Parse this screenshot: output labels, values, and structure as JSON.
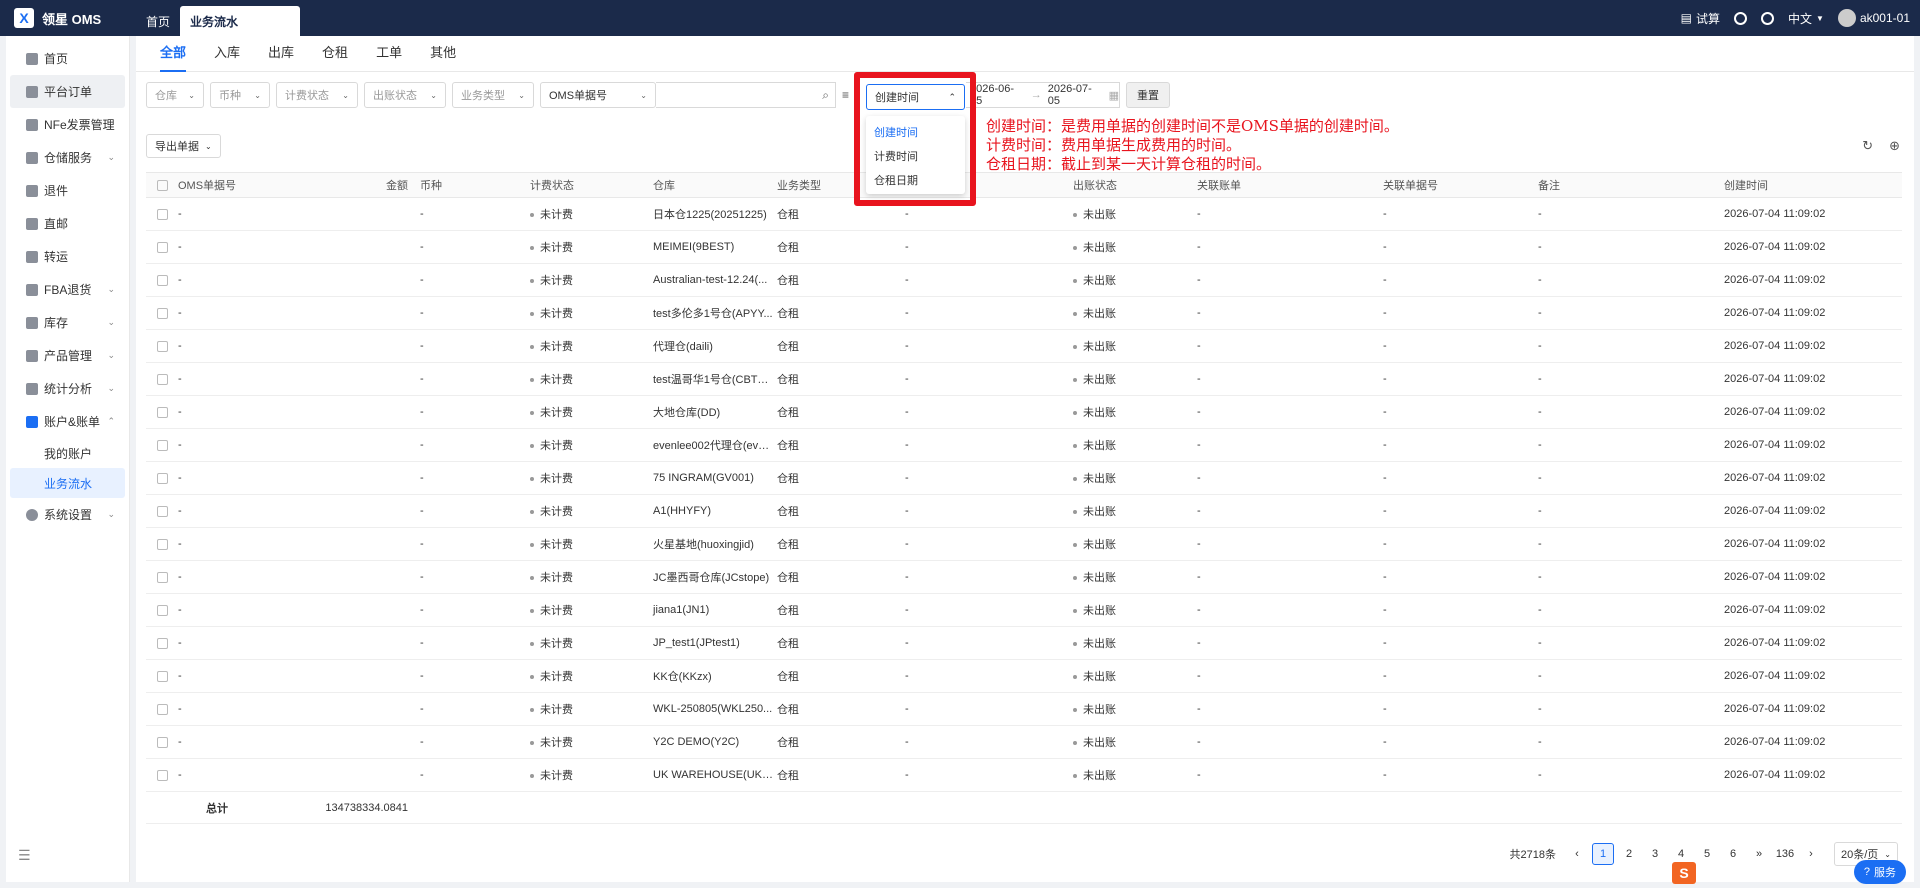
{
  "topbar": {
    "brand_logo": "X",
    "brand": "领星 OMS",
    "tabs": [
      {
        "label": "首页",
        "active": false
      },
      {
        "label": "业务流水",
        "active": true
      }
    ],
    "right": {
      "trial": "试算",
      "language": "中文",
      "user": "ak001-01"
    }
  },
  "sidebar": {
    "items": [
      {
        "label": "首页",
        "icon": "home-icon",
        "expandable": false
      },
      {
        "label": "平台订单",
        "icon": "order-icon",
        "expandable": false
      },
      {
        "label": "NFe发票管理",
        "icon": "invoice-icon",
        "expandable": false
      },
      {
        "label": "仓储服务",
        "icon": "warehouse-icon",
        "expandable": true
      },
      {
        "label": "退件",
        "icon": "return-icon",
        "expandable": false
      },
      {
        "label": "直邮",
        "icon": "mail-icon",
        "expandable": false
      },
      {
        "label": "转运",
        "icon": "transfer-icon",
        "expandable": false
      },
      {
        "label": "FBA退货",
        "icon": "fba-icon",
        "expandable": true
      },
      {
        "label": "库存",
        "icon": "inventory-icon",
        "expandable": true
      },
      {
        "label": "产品管理",
        "icon": "product-icon",
        "expandable": true
      },
      {
        "label": "统计分析",
        "icon": "stats-icon",
        "expandable": true
      },
      {
        "label": "账户&账单",
        "icon": "account-icon",
        "expandable": true,
        "expanded": true
      },
      {
        "label": "我的账户",
        "sub": true
      },
      {
        "label": "业务流水",
        "sub": true,
        "active": true
      },
      {
        "label": "系统设置",
        "icon": "settings-icon",
        "expandable": true
      }
    ]
  },
  "category_tabs": [
    {
      "label": "全部",
      "active": true
    },
    {
      "label": "入库"
    },
    {
      "label": "出库"
    },
    {
      "label": "仓租"
    },
    {
      "label": "工单"
    },
    {
      "label": "其他"
    }
  ],
  "filters": {
    "warehouse": "仓库",
    "currency": "币种",
    "fee_status": "计费状态",
    "bill_status": "出账状态",
    "biz_type": "业务类型",
    "oms_no": "OMS单据号",
    "date_start": "2026-06-05",
    "date_end": "2026-07-05",
    "reset": "重置"
  },
  "date_dropdown": {
    "selected": "创建时间",
    "options": [
      "创建时间",
      "计费时间",
      "仓租日期"
    ]
  },
  "annotations": [
    "创建时间：是费用单据的创建时间不是OMS单据的创建时间。",
    "计费时间：费用单据生成费用的时间。",
    "仓租日期：截止到某一天计算仓租的时间。"
  ],
  "export_button": "导出单据",
  "table": {
    "headers": [
      "OMS单据号",
      "金额",
      "币种",
      "计费状态",
      "仓库",
      "业务类型",
      "出账状态",
      "关联账单",
      "关联单据号",
      "备注",
      "创建时间"
    ],
    "rows": [
      {
        "oms": "-",
        "cur": "-",
        "fee": "未计费",
        "wh": "日本仓1225(20251225)",
        "biz": "仓租",
        "blank": "-",
        "out": "未出账",
        "bill": "-",
        "ref": "-",
        "note": "-",
        "time": "2026-07-04 11:09:02"
      },
      {
        "oms": "-",
        "cur": "-",
        "fee": "未计费",
        "wh": "MEIMEI(9BEST)",
        "biz": "仓租",
        "blank": "-",
        "out": "未出账",
        "bill": "-",
        "ref": "-",
        "note": "-",
        "time": "2026-07-04 11:09:02"
      },
      {
        "oms": "-",
        "cur": "-",
        "fee": "未计费",
        "wh": "Australian-test-12.24(...",
        "biz": "仓租",
        "blank": "-",
        "out": "未出账",
        "bill": "-",
        "ref": "-",
        "note": "-",
        "time": "2026-07-04 11:09:02"
      },
      {
        "oms": "-",
        "cur": "-",
        "fee": "未计费",
        "wh": "test多伦多1号仓(APYY...",
        "biz": "仓租",
        "blank": "-",
        "out": "未出账",
        "bill": "-",
        "ref": "-",
        "note": "-",
        "time": "2026-07-04 11:09:02"
      },
      {
        "oms": "-",
        "cur": "-",
        "fee": "未计费",
        "wh": "代理仓(daili)",
        "biz": "仓租",
        "blank": "-",
        "out": "未出账",
        "bill": "-",
        "ref": "-",
        "note": "-",
        "time": "2026-07-04 11:09:02"
      },
      {
        "oms": "-",
        "cur": "-",
        "fee": "未计费",
        "wh": "test温哥华1号仓(CBTO...",
        "biz": "仓租",
        "blank": "-",
        "out": "未出账",
        "bill": "-",
        "ref": "-",
        "note": "-",
        "time": "2026-07-04 11:09:02"
      },
      {
        "oms": "-",
        "cur": "-",
        "fee": "未计费",
        "wh": "大地仓库(DD)",
        "biz": "仓租",
        "blank": "-",
        "out": "未出账",
        "bill": "-",
        "ref": "-",
        "note": "-",
        "time": "2026-07-04 11:09:02"
      },
      {
        "oms": "-",
        "cur": "-",
        "fee": "未计费",
        "wh": "evenlee002代理仓(eve...",
        "biz": "仓租",
        "blank": "-",
        "out": "未出账",
        "bill": "-",
        "ref": "-",
        "note": "-",
        "time": "2026-07-04 11:09:02"
      },
      {
        "oms": "-",
        "cur": "-",
        "fee": "未计费",
        "wh": "75 INGRAM(GV001)",
        "biz": "仓租",
        "blank": "-",
        "out": "未出账",
        "bill": "-",
        "ref": "-",
        "note": "-",
        "time": "2026-07-04 11:09:02"
      },
      {
        "oms": "-",
        "cur": "-",
        "fee": "未计费",
        "wh": "A1(HHYFY)",
        "biz": "仓租",
        "blank": "-",
        "out": "未出账",
        "bill": "-",
        "ref": "-",
        "note": "-",
        "time": "2026-07-04 11:09:02"
      },
      {
        "oms": "-",
        "cur": "-",
        "fee": "未计费",
        "wh": "火星基地(huoxingjid)",
        "biz": "仓租",
        "blank": "-",
        "out": "未出账",
        "bill": "-",
        "ref": "-",
        "note": "-",
        "time": "2026-07-04 11:09:02"
      },
      {
        "oms": "-",
        "cur": "-",
        "fee": "未计费",
        "wh": "JC墨西哥仓库(JCstope)",
        "biz": "仓租",
        "blank": "-",
        "out": "未出账",
        "bill": "-",
        "ref": "-",
        "note": "-",
        "time": "2026-07-04 11:09:02"
      },
      {
        "oms": "-",
        "cur": "-",
        "fee": "未计费",
        "wh": "jiana1(JN1)",
        "biz": "仓租",
        "blank": "-",
        "out": "未出账",
        "bill": "-",
        "ref": "-",
        "note": "-",
        "time": "2026-07-04 11:09:02"
      },
      {
        "oms": "-",
        "cur": "-",
        "fee": "未计费",
        "wh": "JP_test1(JPtest1)",
        "biz": "仓租",
        "blank": "-",
        "out": "未出账",
        "bill": "-",
        "ref": "-",
        "note": "-",
        "time": "2026-07-04 11:09:02"
      },
      {
        "oms": "-",
        "cur": "-",
        "fee": "未计费",
        "wh": "KK仓(KKzx)",
        "biz": "仓租",
        "blank": "-",
        "out": "未出账",
        "bill": "-",
        "ref": "-",
        "note": "-",
        "time": "2026-07-04 11:09:02"
      },
      {
        "oms": "-",
        "cur": "-",
        "fee": "未计费",
        "wh": "WKL-250805(WKL250...",
        "biz": "仓租",
        "blank": "-",
        "out": "未出账",
        "bill": "-",
        "ref": "-",
        "note": "-",
        "time": "2026-07-04 11:09:02"
      },
      {
        "oms": "-",
        "cur": "-",
        "fee": "未计费",
        "wh": "Y2C DEMO(Y2C)",
        "biz": "仓租",
        "blank": "-",
        "out": "未出账",
        "bill": "-",
        "ref": "-",
        "note": "-",
        "time": "2026-07-04 11:09:02"
      },
      {
        "oms": "-",
        "cur": "-",
        "fee": "未计费",
        "wh": "UK WAREHOUSE(UKW...",
        "biz": "仓租",
        "blank": "-",
        "out": "未出账",
        "bill": "-",
        "ref": "-",
        "note": "-",
        "time": "2026-07-04 11:09:02"
      }
    ],
    "total_label": "总计",
    "total_amount": "134738334.0841"
  },
  "pagination": {
    "total": "共2718条",
    "pages": [
      "1",
      "2",
      "3",
      "4",
      "5",
      "6"
    ],
    "current": "1",
    "more": "»",
    "last": "136",
    "page_size": "20条/页"
  },
  "service_button": "服务",
  "corner_logo": "S",
  "colors": {
    "accent": "#1b6ef3",
    "topbar": "#1b2a4a",
    "annotation": "#e8141e"
  }
}
